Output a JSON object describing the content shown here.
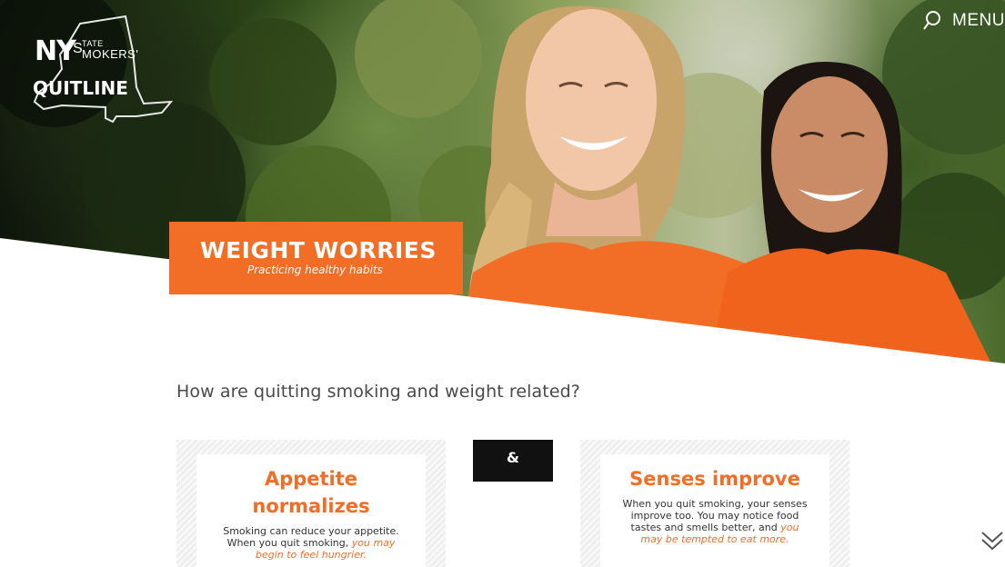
{
  "logo": {
    "ny": "NY",
    "state": "TATE",
    "s": "S",
    "mokers": "MOKERS'",
    "quitline": "QUITLINE"
  },
  "nav": {
    "search_icon": "search-icon",
    "menu_label": "MENU"
  },
  "banner": {
    "title": "WEIGHT WORRIES",
    "subtitle": "Practicing healthy habits"
  },
  "question": "How are quitting smoking and weight related?",
  "amp": "&",
  "cards": [
    {
      "title_line1": "Appetite",
      "title_line2": "normalizes",
      "text_plain": "Smoking can reduce your appetite. When you quit smoking, ",
      "text_highlight": "you may begin to feel hungrier."
    },
    {
      "title": "Senses improve",
      "text_plain": "When you quit smoking, your senses improve too. You may notice food tastes and smells better, and ",
      "text_highlight": "you may be tempted to eat more."
    }
  ],
  "colors": {
    "brand_orange": "#f26d25",
    "dark_box": "#111111",
    "question_text": "#4a4a4a"
  }
}
